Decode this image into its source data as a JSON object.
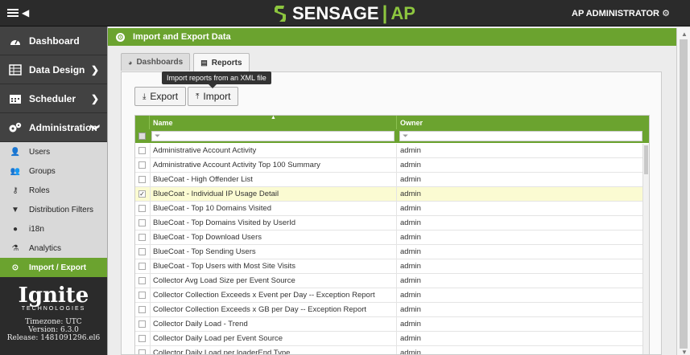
{
  "topbar": {
    "brand_name": "SENSAGE",
    "brand_sep": "|",
    "brand_suffix": "AP",
    "user_label": "AP ADMINISTRATOR"
  },
  "sidebar": {
    "main": [
      {
        "label": "Dashboard",
        "icon": "dashboard-icon"
      },
      {
        "label": "Data Design",
        "icon": "table-icon"
      },
      {
        "label": "Scheduler",
        "icon": "calendar-icon"
      },
      {
        "label": "Administration",
        "icon": "gears-icon"
      }
    ],
    "sub": [
      {
        "label": "Users",
        "icon": "user-icon"
      },
      {
        "label": "Groups",
        "icon": "group-icon"
      },
      {
        "label": "Roles",
        "icon": "key-icon"
      },
      {
        "label": "Distribution Filters",
        "icon": "filter-icon"
      },
      {
        "label": "i18n",
        "icon": "globe-icon"
      },
      {
        "label": "Analytics",
        "icon": "flask-icon"
      }
    ],
    "active": {
      "label": "Import / Export",
      "icon": "import-export-icon"
    },
    "logo": {
      "name": "Ignite",
      "sub": "TECHNOLOGIES",
      "timezone": "Timezone: UTC",
      "version": "Version: 6.3.0",
      "release": "Release: 1481091296.el6"
    }
  },
  "panel": {
    "title": "Import and Export Data",
    "tabs": [
      {
        "label": "Dashboards"
      },
      {
        "label": "Reports"
      }
    ],
    "tooltip": "Import reports from an XML file",
    "export_label": "Export",
    "import_label": "Import"
  },
  "grid": {
    "columns": {
      "name": "Name",
      "owner": "Owner"
    },
    "rows": [
      {
        "name": "Administrative Account Activity",
        "owner": "admin",
        "checked": false
      },
      {
        "name": "Administrative Account Activity Top 100 Summary",
        "owner": "admin",
        "checked": false
      },
      {
        "name": "BlueCoat - High Offender List",
        "owner": "admin",
        "checked": false
      },
      {
        "name": "BlueCoat - Individual IP Usage Detail",
        "owner": "admin",
        "checked": true
      },
      {
        "name": "BlueCoat - Top 10 Domains Visited",
        "owner": "admin",
        "checked": false
      },
      {
        "name": "BlueCoat - Top Domains Visited by UserId",
        "owner": "admin",
        "checked": false
      },
      {
        "name": "BlueCoat - Top Download Users",
        "owner": "admin",
        "checked": false
      },
      {
        "name": "BlueCoat - Top Sending Users",
        "owner": "admin",
        "checked": false
      },
      {
        "name": "BlueCoat - Top Users with Most Site Visits",
        "owner": "admin",
        "checked": false
      },
      {
        "name": "Collector Avg Load Size per Event Source",
        "owner": "admin",
        "checked": false
      },
      {
        "name": "Collector Collection Exceeds x Event per Day -- Exception Report",
        "owner": "admin",
        "checked": false
      },
      {
        "name": "Collector Collection Exceeds x GB per Day -- Exception Report",
        "owner": "admin",
        "checked": false
      },
      {
        "name": "Collector Daily Load - Trend",
        "owner": "admin",
        "checked": false
      },
      {
        "name": "Collector Daily Load per Event Source",
        "owner": "admin",
        "checked": false
      },
      {
        "name": "Collector Daily Load per loaderEnd Type",
        "owner": "admin",
        "checked": false
      }
    ]
  }
}
